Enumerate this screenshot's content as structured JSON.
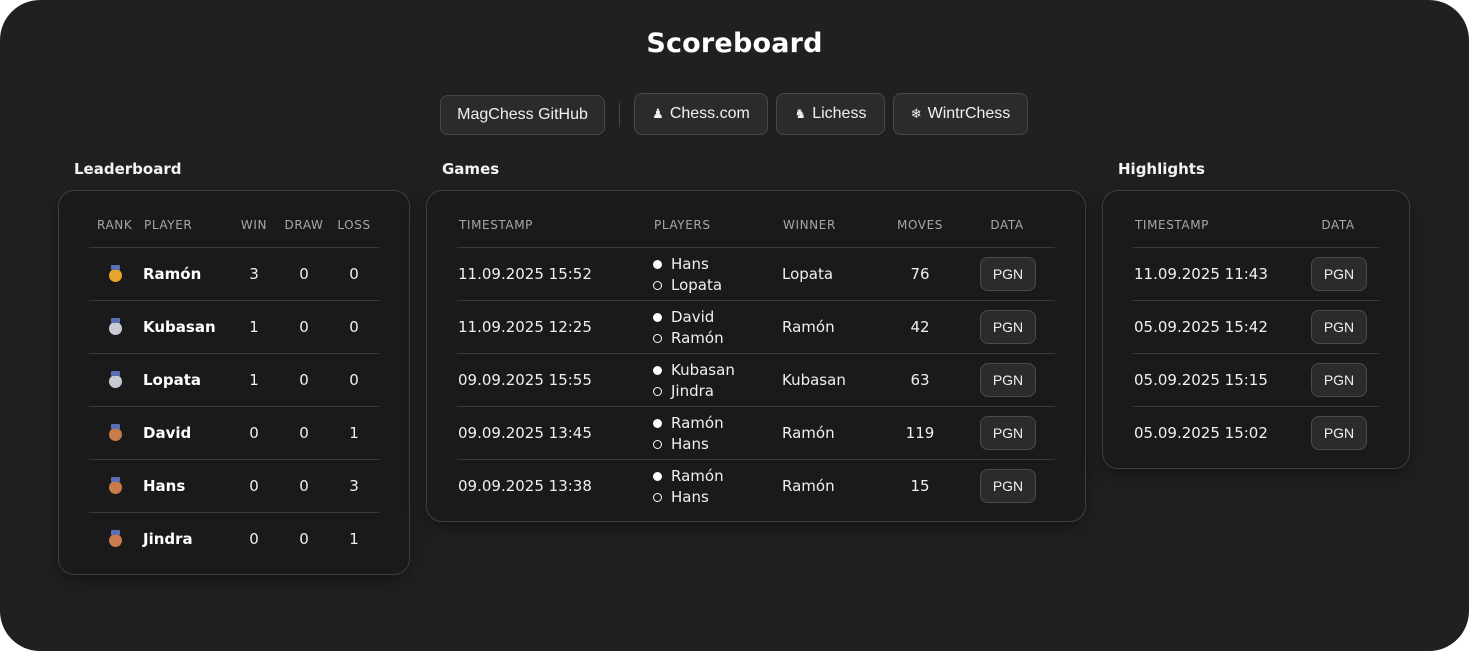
{
  "title": "Scoreboard",
  "nav": [
    {
      "label": "MagChess GitHub",
      "icon": ""
    },
    {
      "label": "Chess.com",
      "icon": "pawn-icon"
    },
    {
      "label": "Lichess",
      "icon": "knight-icon"
    },
    {
      "label": "WintrChess",
      "icon": "snowflake-icon"
    }
  ],
  "leaderboard": {
    "label": "Leaderboard",
    "headers": [
      "RANK",
      "PLAYER",
      "WIN",
      "DRAW",
      "LOSS"
    ],
    "rows": [
      {
        "medal": "gold",
        "player": "Ramón",
        "win": "3",
        "draw": "0",
        "loss": "0"
      },
      {
        "medal": "silver",
        "player": "Kubasan",
        "win": "1",
        "draw": "0",
        "loss": "0"
      },
      {
        "medal": "silver",
        "player": "Lopata",
        "win": "1",
        "draw": "0",
        "loss": "0"
      },
      {
        "medal": "bronze",
        "player": "David",
        "win": "0",
        "draw": "0",
        "loss": "1"
      },
      {
        "medal": "bronze",
        "player": "Hans",
        "win": "0",
        "draw": "0",
        "loss": "3"
      },
      {
        "medal": "bronze",
        "player": "Jindra",
        "win": "0",
        "draw": "0",
        "loss": "1"
      }
    ]
  },
  "games": {
    "label": "Games",
    "headers": [
      "TIMESTAMP",
      "PLAYERS",
      "WINNER",
      "MOVES",
      "DATA"
    ],
    "rows": [
      {
        "timestamp": "11.09.2025 15:52",
        "white": "Hans",
        "black": "Lopata",
        "winner": "Lopata",
        "moves": "76",
        "data": "PGN"
      },
      {
        "timestamp": "11.09.2025 12:25",
        "white": "David",
        "black": "Ramón",
        "winner": "Ramón",
        "moves": "42",
        "data": "PGN"
      },
      {
        "timestamp": "09.09.2025 15:55",
        "white": "Kubasan",
        "black": "Jindra",
        "winner": "Kubasan",
        "moves": "63",
        "data": "PGN"
      },
      {
        "timestamp": "09.09.2025 13:45",
        "white": "Ramón",
        "black": "Hans",
        "winner": "Ramón",
        "moves": "119",
        "data": "PGN"
      },
      {
        "timestamp": "09.09.2025 13:38",
        "white": "Ramón",
        "black": "Hans",
        "winner": "Ramón",
        "moves": "15",
        "data": "PGN"
      }
    ]
  },
  "highlights": {
    "label": "Highlights",
    "headers": [
      "TIMESTAMP",
      "DATA"
    ],
    "rows": [
      {
        "timestamp": "11.09.2025 11:43",
        "data": "PGN"
      },
      {
        "timestamp": "05.09.2025 15:42",
        "data": "PGN"
      },
      {
        "timestamp": "05.09.2025 15:15",
        "data": "PGN"
      },
      {
        "timestamp": "05.09.2025 15:02",
        "data": "PGN"
      }
    ]
  },
  "colors": {
    "background": "#202020",
    "card": "#1a1a1a",
    "gold": "#e7a52a",
    "silver": "#c8cad6",
    "bronze": "#c97c4b"
  }
}
